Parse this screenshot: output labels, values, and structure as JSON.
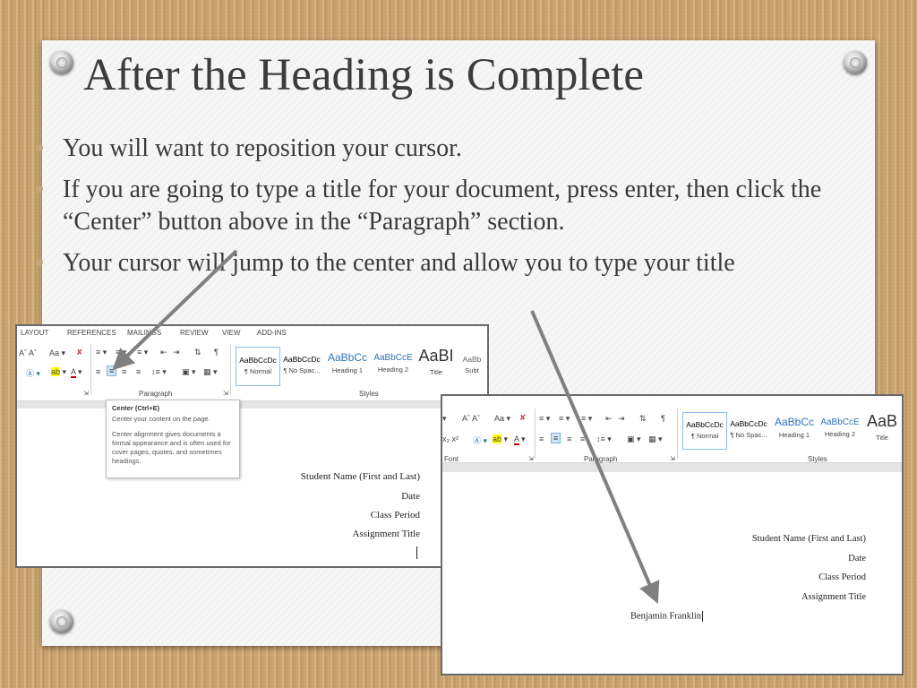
{
  "slide": {
    "title": "After the Heading is Complete",
    "bullets": [
      "You will want to reposition your cursor.",
      "If you are going to type a title for your document, press enter, then click the “Center” button above in the “Paragraph” section.",
      "Your cursor will jump to the center and allow you to type your title"
    ]
  },
  "screenshot_left": {
    "tabs": [
      "LAYOUT",
      "REFERENCES",
      "MAILINGS",
      "REVIEW",
      "VIEW",
      "ADD-INS"
    ],
    "font_size_tools": "Aˆ Aˇ",
    "case_tool": "Aa ▾",
    "paragraph_group_label": "Paragraph",
    "styles_group_label": "Styles",
    "styles": [
      {
        "preview": "AaBbCcDc",
        "label": "¶ Normal"
      },
      {
        "preview": "AaBbCcDc",
        "label": "¶ No Spac..."
      },
      {
        "preview": "AaBbCc",
        "label": "Heading 1"
      },
      {
        "preview": "AaBbCcE",
        "label": "Heading 2"
      },
      {
        "preview": "AaBI",
        "label": "Title"
      },
      {
        "preview": "AaBb",
        "label": "Subt"
      }
    ],
    "tooltip": {
      "title": "Center (Ctrl+E)",
      "line1": "Center your content on the page.",
      "line2": "Center alignment gives documents a formal appearance and is often used for cover pages, quotes, and sometimes headings."
    },
    "doc_lines": [
      "Student Name (First and Last)",
      "Date",
      "Class Period",
      "Assignment Title"
    ]
  },
  "screenshot_right": {
    "font_group_label": "Font",
    "paragraph_group_label": "Paragraph",
    "styles_group_label": "Styles",
    "styles": [
      {
        "preview": "AaBbCcDc",
        "label": "¶ Normal"
      },
      {
        "preview": "AaBbCcDc",
        "label": "¶ No Spac..."
      },
      {
        "preview": "AaBbCc",
        "label": "Heading 1"
      },
      {
        "preview": "AaBbCcE",
        "label": "Heading 2"
      },
      {
        "preview": "AaB",
        "label": "Title"
      }
    ],
    "doc_lines": [
      "Student Name (First and Last)",
      "Date",
      "Class Period",
      "Assignment Title"
    ],
    "typed_title": "Benjamin Franklin"
  },
  "colors": {
    "wood": "#c9a26e",
    "card": "#f6f6f6",
    "bullet": "#c4a57a",
    "arrow": "#808080",
    "heading_blue": "#2e74b5"
  }
}
